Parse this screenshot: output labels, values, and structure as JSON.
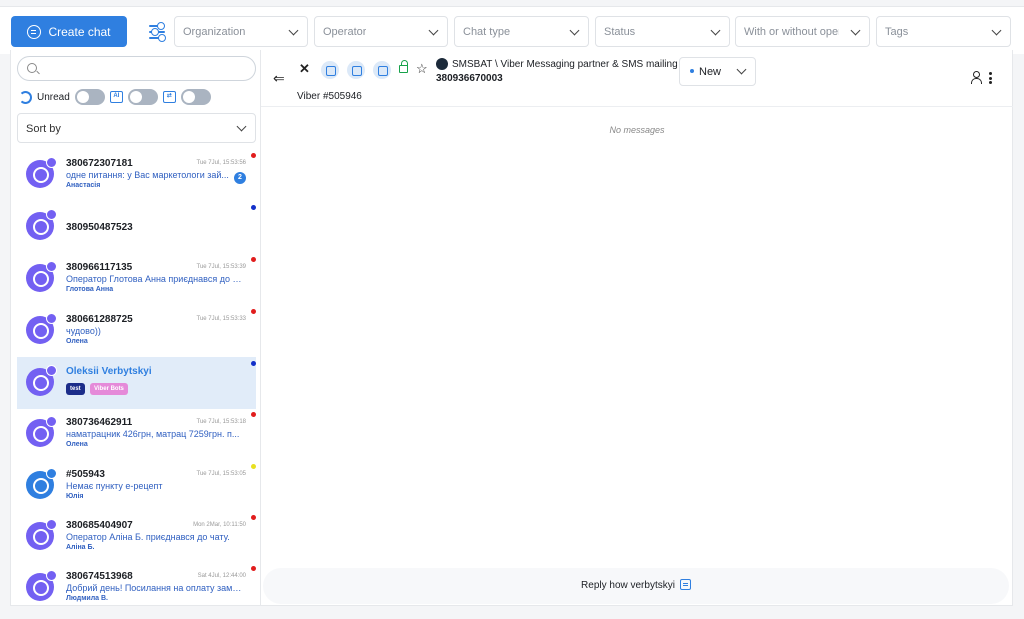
{
  "topbar": {
    "create_chat_label": "Create chat",
    "filters": [
      {
        "placeholder": "Organization"
      },
      {
        "placeholder": "Operator"
      },
      {
        "placeholder": "Chat type"
      },
      {
        "placeholder": "Status"
      },
      {
        "placeholder": "With or without opera"
      },
      {
        "placeholder": "Tags"
      }
    ]
  },
  "sidebar": {
    "search_placeholder": "",
    "unread_label": "Unread",
    "sort_placeholder": "Sort by"
  },
  "chats": [
    {
      "name": "380672307181",
      "time": "Tue 7Jul, 15:53:56",
      "message": "одне питання: у Вас маркетологи зай...",
      "operator": "Анастасія",
      "unread": "2",
      "dot_color": "#e11d1d",
      "channel": "viber"
    },
    {
      "name": "380950487523",
      "time": "",
      "message": "",
      "operator": "",
      "unread": "",
      "dot_color": "#1330c9",
      "channel": "viber"
    },
    {
      "name": "380966117135",
      "time": "Tue 7Jul, 15:53:39",
      "message": "Оператор Глотова Анна приєднався до ч...",
      "operator": "Глотова Анна",
      "unread": "",
      "dot_color": "#e11d1d",
      "channel": "viber"
    },
    {
      "name": "380661288725",
      "time": "Tue 7Jul, 15:53:33",
      "message": "чудово))",
      "operator": "Олена",
      "unread": "",
      "dot_color": "#e11d1d",
      "channel": "viber"
    },
    {
      "name": "Oleksii Verbytskyi",
      "time": "",
      "message": "",
      "operator": "",
      "unread": "",
      "dot_color": "#1330c9",
      "channel": "viber",
      "selected": true,
      "tags": [
        {
          "label": "test",
          "color": "#1c2d8a"
        },
        {
          "label": "Viber Bots",
          "color": "#e58ad9"
        }
      ]
    },
    {
      "name": "380736462911",
      "time": "Tue 7Jul, 15:53:18",
      "message": "наматрацник 426грн, матрац 7259грн. п...",
      "operator": "Олена",
      "unread": "",
      "dot_color": "#e11d1d",
      "channel": "viber"
    },
    {
      "name": "#505943",
      "time": "Tue 7Jul, 15:53:05",
      "message": "Немає пункту е-рецепт",
      "operator": "Юлія",
      "unread": "",
      "dot_color": "#e8e020",
      "channel": "other"
    },
    {
      "name": "380685404907",
      "time": "Mon 2Mar, 10:11:50",
      "message": "Оператор Аліна Б. приєднався до чату.",
      "operator": "Аліна Б.",
      "unread": "",
      "dot_color": "#e11d1d",
      "channel": "viber"
    },
    {
      "name": "380674513968",
      "time": "Sat 4Jul, 12:44:00",
      "message": "Добрий день! Посилання на оплату замо...",
      "operator": "Людмила В.",
      "unread": "",
      "dot_color": "#e11d1d",
      "channel": "viber"
    }
  ],
  "conversation": {
    "channel_name": "SMSBAT \\ Viber Messaging partner & SMS mailing",
    "phone": "380936670003",
    "status": "New",
    "chat_id": "Viber #505946",
    "empty_text": "No messages",
    "reply_text": "Reply how  verbytskyi"
  }
}
